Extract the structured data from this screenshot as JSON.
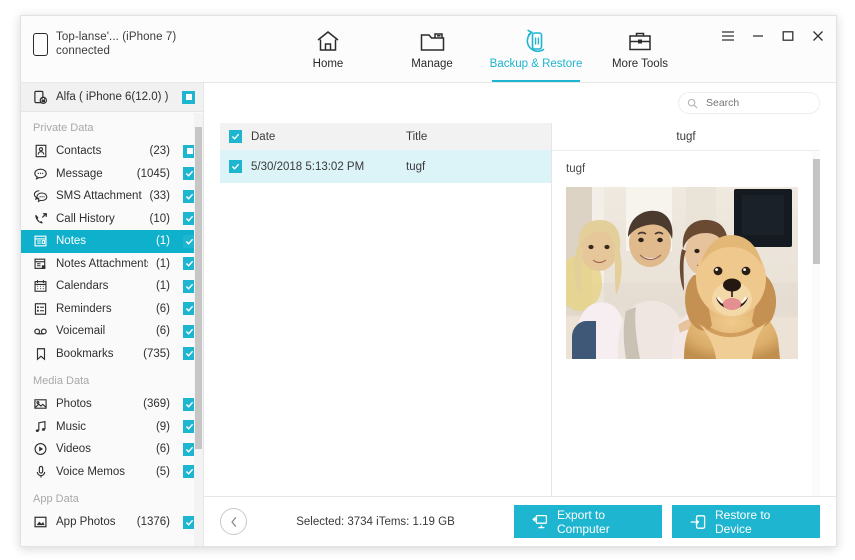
{
  "window": {
    "device_label": "Top-lanse'... (iPhone 7)\nconnected",
    "device_icon": "phone-icon",
    "controls": {
      "menu": "menu-icon",
      "minimize": "minimize-icon",
      "maximize": "maximize-icon",
      "close": "close-icon"
    }
  },
  "nav": {
    "tabs": [
      {
        "label": "Home",
        "icon": "home-icon",
        "active": false
      },
      {
        "label": "Manage",
        "icon": "folder-icon",
        "active": false
      },
      {
        "label": "Backup & Restore",
        "icon": "backup-restore-icon",
        "active": true
      },
      {
        "label": "More Tools",
        "icon": "toolbox-icon",
        "active": false
      }
    ]
  },
  "sidebar": {
    "device": {
      "label": "Alfa ( iPhone 6(12.0) )",
      "icon": "backup-device-icon",
      "checkbox": "partial"
    },
    "groups": [
      {
        "title": "Private Data",
        "items": [
          {
            "label": "Contacts",
            "count": "(23)",
            "icon": "contacts-icon",
            "checkbox": "partial",
            "active": false
          },
          {
            "label": "Message",
            "count": "(1045)",
            "icon": "message-icon",
            "checkbox": "checked",
            "active": false
          },
          {
            "label": "SMS Attachments",
            "count": "(33)",
            "icon": "sms-attachments-icon",
            "checkbox": "checked",
            "active": false
          },
          {
            "label": "Call History",
            "count": "(10)",
            "icon": "call-history-icon",
            "checkbox": "checked",
            "active": false
          },
          {
            "label": "Notes",
            "count": "(1)",
            "icon": "notes-icon",
            "checkbox": "checked",
            "active": true
          },
          {
            "label": "Notes Attachments",
            "count": "(1)",
            "icon": "notes-attachments-icon",
            "checkbox": "checked",
            "active": false
          },
          {
            "label": "Calendars",
            "count": "(1)",
            "icon": "calendar-icon",
            "checkbox": "checked",
            "active": false
          },
          {
            "label": "Reminders",
            "count": "(6)",
            "icon": "reminders-icon",
            "checkbox": "checked",
            "active": false
          },
          {
            "label": "Voicemail",
            "count": "(6)",
            "icon": "voicemail-icon",
            "checkbox": "checked",
            "active": false
          },
          {
            "label": "Bookmarks",
            "count": "(735)",
            "icon": "bookmark-icon",
            "checkbox": "checked",
            "active": false
          }
        ]
      },
      {
        "title": "Media Data",
        "items": [
          {
            "label": "Photos",
            "count": "(369)",
            "icon": "photos-icon",
            "checkbox": "checked",
            "active": false
          },
          {
            "label": "Music",
            "count": "(9)",
            "icon": "music-icon",
            "checkbox": "checked",
            "active": false
          },
          {
            "label": "Videos",
            "count": "(6)",
            "icon": "videos-icon",
            "checkbox": "checked",
            "active": false
          },
          {
            "label": "Voice Memos",
            "count": "(5)",
            "icon": "voice-memos-icon",
            "checkbox": "checked",
            "active": false
          }
        ]
      },
      {
        "title": "App Data",
        "items": [
          {
            "label": "App Photos",
            "count": "(1376)",
            "icon": "app-photos-icon",
            "checkbox": "checked",
            "active": false
          }
        ]
      }
    ]
  },
  "search": {
    "placeholder": "Search",
    "value": "",
    "icon": "search-icon"
  },
  "list": {
    "columns": [
      "Date",
      "Title"
    ],
    "header_checkbox": "checked",
    "rows": [
      {
        "checkbox": "checked",
        "date": "5/30/2018 5:13:02 PM",
        "title": "tugf",
        "selected": true
      }
    ]
  },
  "preview": {
    "header": "tugf",
    "note_title": "tugf",
    "photo_alt": "family-with-golden-retriever-photo"
  },
  "footer": {
    "back_icon": "chevron-left-icon",
    "selection_summary": "Selected: 3734 iTems: 1.19 GB",
    "export_label": "Export to Computer",
    "export_icon": "export-to-computer-icon",
    "restore_label": "Restore to Device",
    "restore_icon": "restore-to-device-icon"
  },
  "colors": {
    "accent": "#1eb5d0",
    "accent_dark": "#0fb0cc",
    "row_selected": "#dcf3f8",
    "header_bg": "#f2f2f2",
    "sidebar_bg": "#fafafa"
  }
}
